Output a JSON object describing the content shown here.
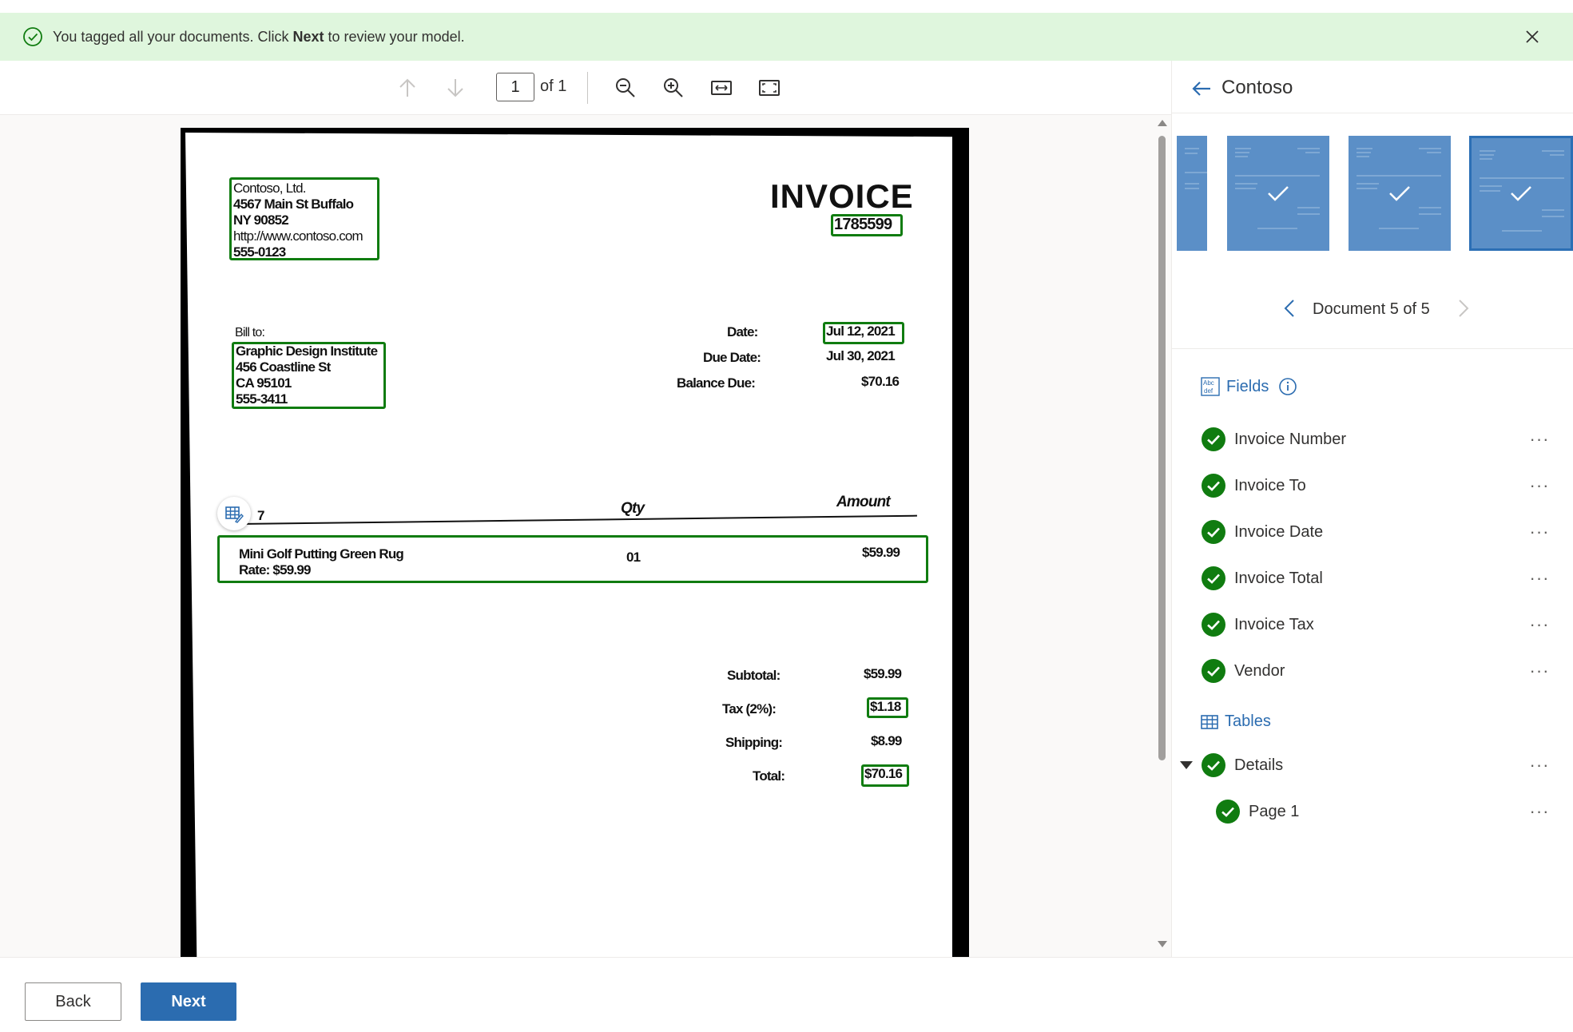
{
  "banner": {
    "message_pre": "You tagged all your documents. Click ",
    "message_bold": "Next",
    "message_post": " to review your model."
  },
  "toolbar": {
    "page_current": "1",
    "page_of": "of 1"
  },
  "document": {
    "vendor_lines": [
      "Contoso, Ltd.",
      "4567 Main St Buffalo",
      "NY 90852",
      "http://www.contoso.com",
      "555-0123"
    ],
    "title": "INVOICE",
    "invoice_number": "1785599",
    "bill_to_label": "Bill to:",
    "bill_to_lines": [
      "Graphic Design Institute",
      "456 Coastline St",
      "CA 95101",
      "555-3411"
    ],
    "date_label": "Date:",
    "date_value": "Jul 12, 2021",
    "due_label": "Due Date:",
    "due_value": "Jul 30, 2021",
    "balance_label": "Balance Due:",
    "balance_value": "$70.16",
    "col_item": "7",
    "col_qty": "Qty",
    "col_amount": "Amount",
    "item_name": "Mini Golf Putting Green Rug",
    "item_rate": "Rate: $59.99",
    "item_qty": "01",
    "item_amount": "$59.99",
    "subtotal_label": "Subtotal:",
    "subtotal_value": "$59.99",
    "tax_label": "Tax (2%):",
    "tax_value": "$1.18",
    "shipping_label": "Shipping:",
    "shipping_value": "$8.99",
    "total_label": "Total:",
    "total_value": "$70.16"
  },
  "panel": {
    "title": "Contoso",
    "doc_nav_label": "Document 5 of 5",
    "fields_heading": "Fields",
    "fields": [
      {
        "name": "Invoice Number"
      },
      {
        "name": "Invoice To"
      },
      {
        "name": "Invoice Date"
      },
      {
        "name": "Invoice Total"
      },
      {
        "name": "Invoice Tax"
      },
      {
        "name": "Vendor"
      }
    ],
    "tables_heading": "Tables",
    "tables": [
      {
        "name": "Details"
      },
      {
        "name": "Page 1"
      }
    ]
  },
  "footer": {
    "back_label": "Back",
    "next_label": "Next"
  },
  "colors": {
    "accent": "#2b6cb0",
    "success": "#107c10",
    "banner_bg": "#dff6dd"
  }
}
